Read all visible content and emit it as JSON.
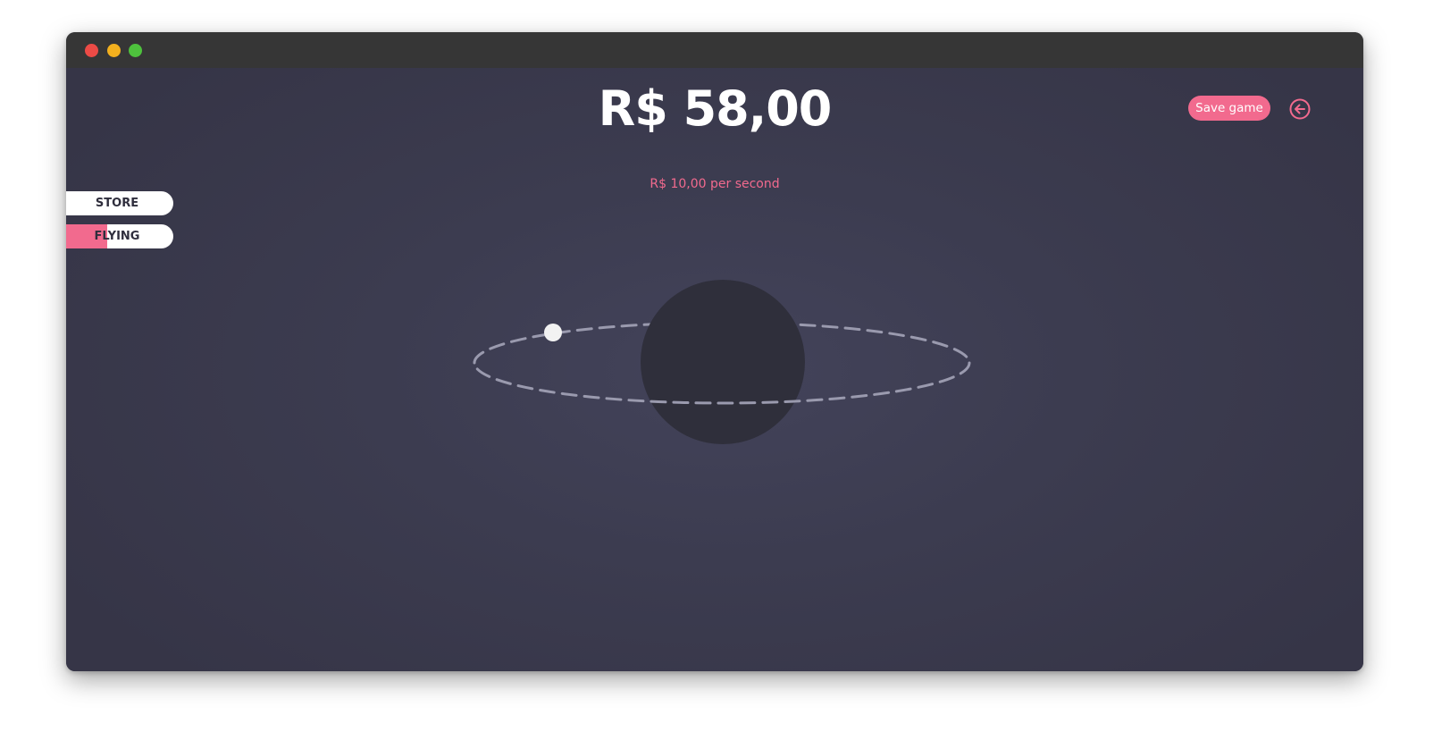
{
  "game": {
    "balance": "R$ 58,00",
    "rate": "R$ 10,00 per second",
    "save_label": "Save game",
    "back_icon": "arrow-left-circle-icon"
  },
  "menu": {
    "store_label": "STORE",
    "flying_label": "FLYING",
    "flying_progress": 0.38
  },
  "colors": {
    "accent": "#f26a8e",
    "background": "#383748",
    "planet": "#2f2f3b",
    "orbit": "#9a9aae",
    "moon": "#f2f2f2"
  }
}
